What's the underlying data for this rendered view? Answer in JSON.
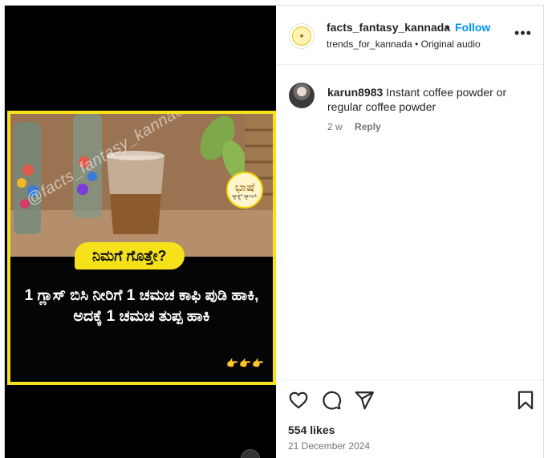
{
  "post": {
    "username": "facts_fantasy_kannada",
    "dot": "•",
    "follow_label": "Follow",
    "subline": "trends_for_kannada • Original audio",
    "more_label": "•••"
  },
  "media": {
    "watermark": "@facts_fantasy_kannada",
    "logo_glyph": "ಭಾಷೆ",
    "logo_text": "ಫ್ಯಾಕ್ಟ್ಸ್ ಫ್ಯಾಂಟಸಿ",
    "question": "ನಿಮಗೆ ಗೊತ್ತೇ?",
    "caption": "1 ಗ್ಲಾಸ್ ಬಿಸಿ ನೀರಿಗೆ 1 ಚಮಚ ಕಾಫಿ ಪುಡಿ ಹಾಕಿ, ಅದಕ್ಕೆ 1 ಚಮಚ ತುಪ್ಪ ಹಾಕಿ",
    "pointers": "👉👉👉"
  },
  "comments": [
    {
      "user": "karun8983",
      "text": "Instant coffee powder or regular coffee powder",
      "age": "2 w",
      "reply_label": "Reply"
    }
  ],
  "footer": {
    "likes": "554 likes",
    "date": "21 December 2024"
  },
  "icons": [
    "heart-icon",
    "comment-icon",
    "share-icon",
    "bookmark-icon",
    "more-icon"
  ]
}
